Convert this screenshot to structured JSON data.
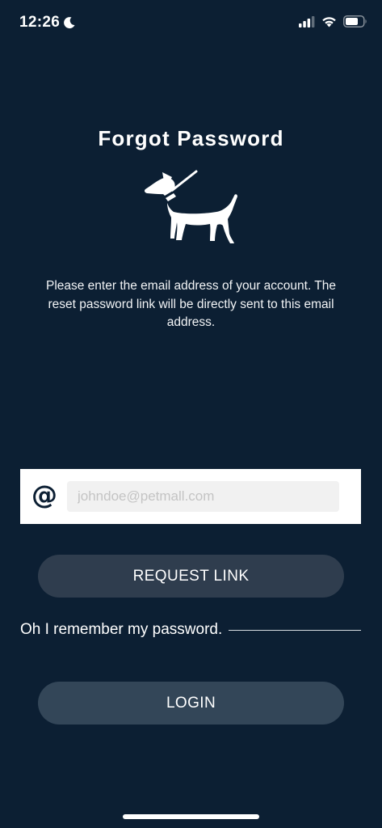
{
  "status_bar": {
    "time": "12:26",
    "icons": [
      "moon-icon",
      "cellular-signal-icon",
      "wifi-icon",
      "battery-icon"
    ]
  },
  "page": {
    "title": "Forgot Password",
    "illustration": "dog-icon",
    "description": "Please enter the email address of your account. The reset password link will be directly sent to this email address."
  },
  "email_field": {
    "icon_glyph": "@",
    "placeholder": "johndoe@petmall.com",
    "value": ""
  },
  "request_button": {
    "label": "REQUEST LINK"
  },
  "remember": {
    "text": "Oh I remember my password."
  },
  "login_button": {
    "label": "LOGIN"
  },
  "colors": {
    "background": "#0c1f33",
    "request_button": "#2f3d4e",
    "login_button": "#334658",
    "input_background": "#f1f1f1"
  }
}
